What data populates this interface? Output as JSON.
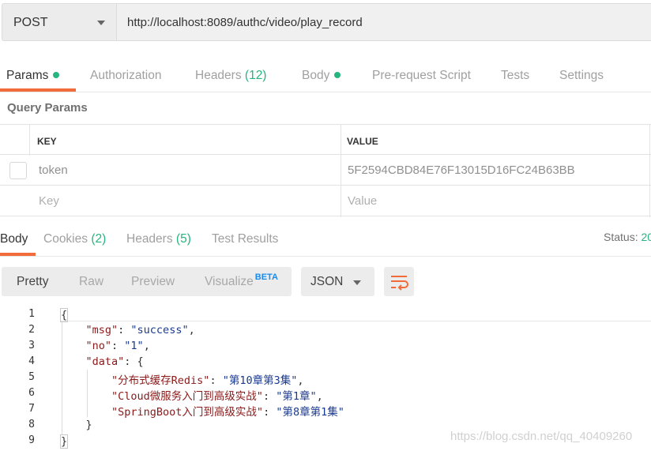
{
  "request": {
    "method": "POST",
    "url": "http://localhost:8089/authc/video/play_record"
  },
  "request_tabs": {
    "params": "Params",
    "authorization": "Authorization",
    "headers": "Headers",
    "headers_count": "(12)",
    "body": "Body",
    "pre_request_script": "Pre-request Script",
    "tests": "Tests",
    "settings": "Settings"
  },
  "query_params": {
    "title": "Query Params",
    "columns": {
      "key": "KEY",
      "value": "VALUE"
    },
    "rows": [
      {
        "key": "token",
        "value": "5F2594CBD84E76F13015D16FC24B63BB"
      }
    ],
    "placeholder": {
      "key": "Key",
      "value": "Value"
    }
  },
  "response_tabs": {
    "body": "Body",
    "cookies": "Cookies",
    "cookies_count": "(2)",
    "headers": "Headers",
    "headers_count": "(5)",
    "test_results": "Test Results",
    "status_label": "Status:",
    "status_value": "20"
  },
  "view_modes": {
    "pretty": "Pretty",
    "raw": "Raw",
    "preview": "Preview",
    "visualize": "Visualize",
    "beta": "BETA"
  },
  "format": {
    "selected": "JSON"
  },
  "code": {
    "line_numbers": [
      "1",
      "2",
      "3",
      "4",
      "5",
      "6",
      "7",
      "8",
      "9"
    ],
    "open_brace": "{",
    "close_brace": "}",
    "data_close": "}",
    "msg_key": "\"msg\"",
    "msg_val": "\"success\"",
    "no_key": "\"no\"",
    "no_val": "\"1\"",
    "data_key": "\"data\"",
    "entries": [
      {
        "key": "\"分布式缓存Redis\"",
        "val": "\"第10章第3集\"",
        "comma": ","
      },
      {
        "key": "\"Cloud微服务入门到高级实战\"",
        "val": "\"第1章\"",
        "comma": ","
      },
      {
        "key": "\"SpringBoot入门到高级实战\"",
        "val": "\"第8章第1集\"",
        "comma": ""
      }
    ]
  },
  "watermark": "https://blog.csdn.net/qq_40409260",
  "colors": {
    "accent": "#f26b3a",
    "success": "#26b47f",
    "beta": "#1a8be8"
  }
}
